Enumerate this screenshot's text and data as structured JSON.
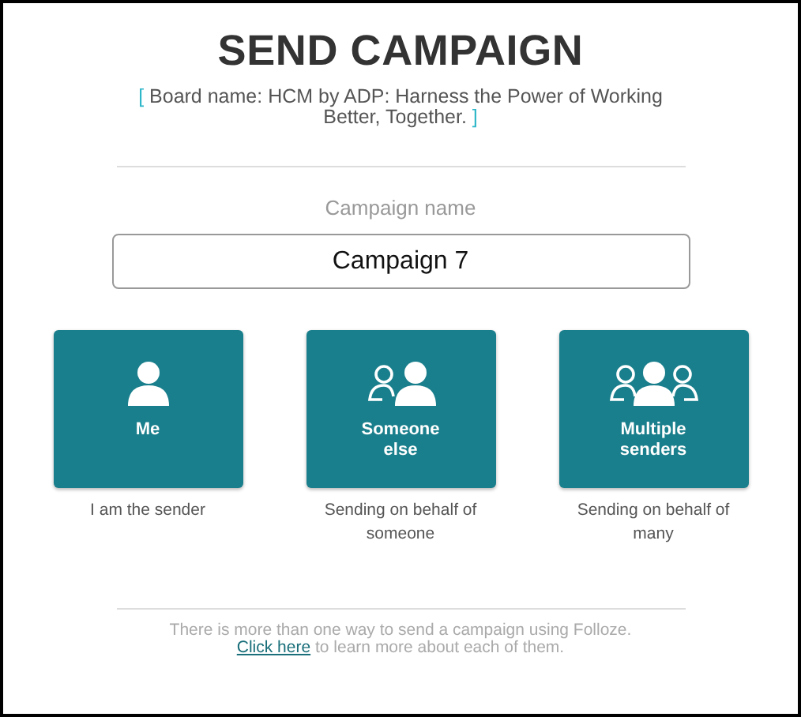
{
  "title": "SEND CAMPAIGN",
  "board_name": {
    "open": "[",
    "text": "Board name: HCM by ADP: Harness the Power of Working Better, Together.",
    "close": "]"
  },
  "campaign_name": {
    "label": "Campaign name",
    "value": "Campaign 7"
  },
  "options": [
    {
      "kind": "single",
      "label": "Me",
      "caption": "I am the sender"
    },
    {
      "kind": "other",
      "label": "Someone else",
      "caption": "Sending on behalf of someone"
    },
    {
      "kind": "multiple",
      "label": "Multiple senders",
      "caption": "Sending on behalf of many"
    }
  ],
  "footer": {
    "text_before": "There is more than one way to send a campaign using Folloze.",
    "link": "Click here",
    "text_after": "to learn more about each of them."
  }
}
